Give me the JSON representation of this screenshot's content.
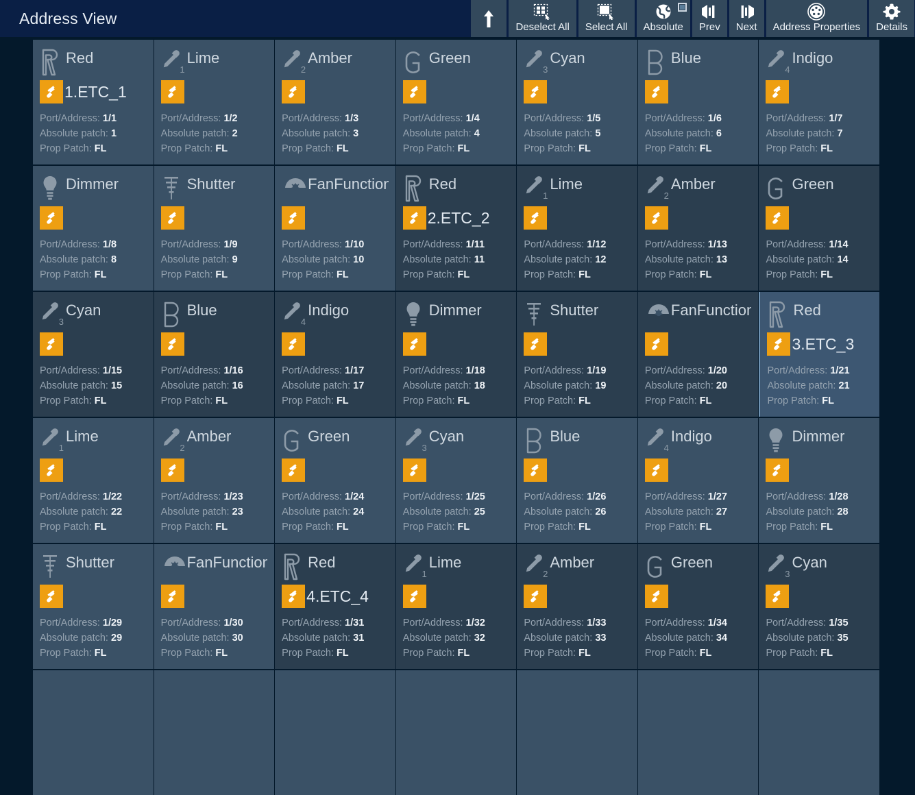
{
  "window": {
    "title": "Address View"
  },
  "toolbar": {
    "buttons": [
      {
        "icon": "arrow-up-icon",
        "label": "",
        "name": "up-level-button",
        "checkbox": false
      },
      {
        "icon": "deselect-all-icon",
        "label": "Deselect All",
        "name": "deselect-all-button",
        "checkbox": false
      },
      {
        "icon": "select-all-icon",
        "label": "Select All",
        "name": "select-all-button",
        "checkbox": false
      },
      {
        "icon": "globe-icon",
        "label": "Absolute",
        "name": "absolute-toggle-button",
        "checkbox": true
      },
      {
        "icon": "prev-icon",
        "label": "Prev",
        "name": "prev-button",
        "checkbox": false
      },
      {
        "icon": "next-icon",
        "label": "Next",
        "name": "next-button",
        "checkbox": false
      },
      {
        "icon": "address-properties-icon",
        "label": "Address Properties",
        "name": "address-properties-button",
        "checkbox": false
      },
      {
        "icon": "gear-icon",
        "label": "Details",
        "name": "details-button",
        "checkbox": false
      }
    ]
  },
  "labels": {
    "port_address": "Port/Address:",
    "absolute_patch": "Absolute patch:",
    "prop_patch": "Prop Patch:"
  },
  "colors": {
    "accent": "#ee9f12",
    "titlebar": "#0a1f45",
    "page_bg": "#04192b",
    "cell_bg": "#3a5166",
    "cell_bg_dark": "#2b3e4f",
    "cell_bg_selected": "#3d5772",
    "toolbar_btn": "#33495c"
  },
  "grid": {
    "columns": 7,
    "rows": [
      [
        {
          "type": "Red",
          "icon": "letter-r-icon",
          "sub": "",
          "fixture": "1.ETC_1",
          "port_address": "1/1",
          "absolute_patch": "1",
          "prop_patch": "FL",
          "state": "normal"
        },
        {
          "type": "Lime",
          "icon": "pipette-icon",
          "sub": "1",
          "fixture": "",
          "port_address": "1/2",
          "absolute_patch": "2",
          "prop_patch": "FL",
          "state": "normal"
        },
        {
          "type": "Amber",
          "icon": "pipette-icon",
          "sub": "2",
          "fixture": "",
          "port_address": "1/3",
          "absolute_patch": "3",
          "prop_patch": "FL",
          "state": "normal"
        },
        {
          "type": "Green",
          "icon": "letter-g-icon",
          "sub": "",
          "fixture": "",
          "port_address": "1/4",
          "absolute_patch": "4",
          "prop_patch": "FL",
          "state": "normal"
        },
        {
          "type": "Cyan",
          "icon": "pipette-icon",
          "sub": "3",
          "fixture": "",
          "port_address": "1/5",
          "absolute_patch": "5",
          "prop_patch": "FL",
          "state": "normal"
        },
        {
          "type": "Blue",
          "icon": "letter-b-icon",
          "sub": "",
          "fixture": "",
          "port_address": "1/6",
          "absolute_patch": "6",
          "prop_patch": "FL",
          "state": "normal"
        },
        {
          "type": "Indigo",
          "icon": "pipette-icon",
          "sub": "4",
          "fixture": "",
          "port_address": "1/7",
          "absolute_patch": "7",
          "prop_patch": "FL",
          "state": "normal"
        }
      ],
      [
        {
          "type": "Dimmer",
          "icon": "lightbulb-icon",
          "sub": "",
          "fixture": "",
          "port_address": "1/8",
          "absolute_patch": "8",
          "prop_patch": "FL",
          "state": "normal"
        },
        {
          "type": "Shutter",
          "icon": "shutter-icon",
          "sub": "",
          "fixture": "",
          "port_address": "1/9",
          "absolute_patch": "9",
          "prop_patch": "FL",
          "state": "normal"
        },
        {
          "type": "FanFunction",
          "icon": "fan-icon",
          "sub": "",
          "fixture": "",
          "port_address": "1/10",
          "absolute_patch": "10",
          "prop_patch": "FL",
          "state": "normal"
        },
        {
          "type": "Red",
          "icon": "letter-r-icon",
          "sub": "",
          "fixture": "2.ETC_2",
          "port_address": "1/11",
          "absolute_patch": "11",
          "prop_patch": "FL",
          "state": "dark"
        },
        {
          "type": "Lime",
          "icon": "pipette-icon",
          "sub": "1",
          "fixture": "",
          "port_address": "1/12",
          "absolute_patch": "12",
          "prop_patch": "FL",
          "state": "dark"
        },
        {
          "type": "Amber",
          "icon": "pipette-icon",
          "sub": "2",
          "fixture": "",
          "port_address": "1/13",
          "absolute_patch": "13",
          "prop_patch": "FL",
          "state": "dark"
        },
        {
          "type": "Green",
          "icon": "letter-g-icon",
          "sub": "",
          "fixture": "",
          "port_address": "1/14",
          "absolute_patch": "14",
          "prop_patch": "FL",
          "state": "dark"
        }
      ],
      [
        {
          "type": "Cyan",
          "icon": "pipette-icon",
          "sub": "3",
          "fixture": "",
          "port_address": "1/15",
          "absolute_patch": "15",
          "prop_patch": "FL",
          "state": "dark"
        },
        {
          "type": "Blue",
          "icon": "letter-b-icon",
          "sub": "",
          "fixture": "",
          "port_address": "1/16",
          "absolute_patch": "16",
          "prop_patch": "FL",
          "state": "dark"
        },
        {
          "type": "Indigo",
          "icon": "pipette-icon",
          "sub": "4",
          "fixture": "",
          "port_address": "1/17",
          "absolute_patch": "17",
          "prop_patch": "FL",
          "state": "dark"
        },
        {
          "type": "Dimmer",
          "icon": "lightbulb-icon",
          "sub": "",
          "fixture": "",
          "port_address": "1/18",
          "absolute_patch": "18",
          "prop_patch": "FL",
          "state": "dark"
        },
        {
          "type": "Shutter",
          "icon": "shutter-icon",
          "sub": "",
          "fixture": "",
          "port_address": "1/19",
          "absolute_patch": "19",
          "prop_patch": "FL",
          "state": "dark"
        },
        {
          "type": "FanFunction",
          "icon": "fan-icon",
          "sub": "",
          "fixture": "",
          "port_address": "1/20",
          "absolute_patch": "20",
          "prop_patch": "FL",
          "state": "dark"
        },
        {
          "type": "Red",
          "icon": "letter-r-icon",
          "sub": "",
          "fixture": "3.ETC_3",
          "port_address": "1/21",
          "absolute_patch": "21",
          "prop_patch": "FL",
          "state": "selected"
        }
      ],
      [
        {
          "type": "Lime",
          "icon": "pipette-icon",
          "sub": "1",
          "fixture": "",
          "port_address": "1/22",
          "absolute_patch": "22",
          "prop_patch": "FL",
          "state": "normal"
        },
        {
          "type": "Amber",
          "icon": "pipette-icon",
          "sub": "2",
          "fixture": "",
          "port_address": "1/23",
          "absolute_patch": "23",
          "prop_patch": "FL",
          "state": "normal"
        },
        {
          "type": "Green",
          "icon": "letter-g-icon",
          "sub": "",
          "fixture": "",
          "port_address": "1/24",
          "absolute_patch": "24",
          "prop_patch": "FL",
          "state": "normal"
        },
        {
          "type": "Cyan",
          "icon": "pipette-icon",
          "sub": "3",
          "fixture": "",
          "port_address": "1/25",
          "absolute_patch": "25",
          "prop_patch": "FL",
          "state": "normal"
        },
        {
          "type": "Blue",
          "icon": "letter-b-icon",
          "sub": "",
          "fixture": "",
          "port_address": "1/26",
          "absolute_patch": "26",
          "prop_patch": "FL",
          "state": "normal"
        },
        {
          "type": "Indigo",
          "icon": "pipette-icon",
          "sub": "4",
          "fixture": "",
          "port_address": "1/27",
          "absolute_patch": "27",
          "prop_patch": "FL",
          "state": "normal"
        },
        {
          "type": "Dimmer",
          "icon": "lightbulb-icon",
          "sub": "",
          "fixture": "",
          "port_address": "1/28",
          "absolute_patch": "28",
          "prop_patch": "FL",
          "state": "normal"
        }
      ],
      [
        {
          "type": "Shutter",
          "icon": "shutter-icon",
          "sub": "",
          "fixture": "",
          "port_address": "1/29",
          "absolute_patch": "29",
          "prop_patch": "FL",
          "state": "normal"
        },
        {
          "type": "FanFunction",
          "icon": "fan-icon",
          "sub": "",
          "fixture": "",
          "port_address": "1/30",
          "absolute_patch": "30",
          "prop_patch": "FL",
          "state": "normal"
        },
        {
          "type": "Red",
          "icon": "letter-r-icon",
          "sub": "",
          "fixture": "4.ETC_4",
          "port_address": "1/31",
          "absolute_patch": "31",
          "prop_patch": "FL",
          "state": "dark"
        },
        {
          "type": "Lime",
          "icon": "pipette-icon",
          "sub": "1",
          "fixture": "",
          "port_address": "1/32",
          "absolute_patch": "32",
          "prop_patch": "FL",
          "state": "dark"
        },
        {
          "type": "Amber",
          "icon": "pipette-icon",
          "sub": "2",
          "fixture": "",
          "port_address": "1/33",
          "absolute_patch": "33",
          "prop_patch": "FL",
          "state": "dark"
        },
        {
          "type": "Green",
          "icon": "letter-g-icon",
          "sub": "",
          "fixture": "",
          "port_address": "1/34",
          "absolute_patch": "34",
          "prop_patch": "FL",
          "state": "dark"
        },
        {
          "type": "Cyan",
          "icon": "pipette-icon",
          "sub": "3",
          "fixture": "",
          "port_address": "1/35",
          "absolute_patch": "35",
          "prop_patch": "FL",
          "state": "dark"
        }
      ]
    ],
    "partial_row_visible": true
  }
}
